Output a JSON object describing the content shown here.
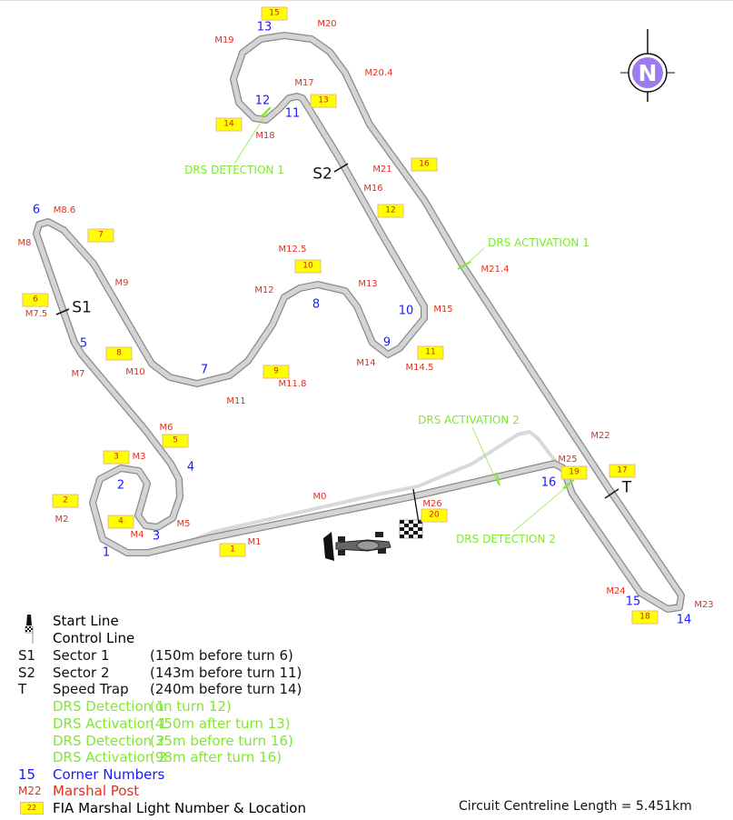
{
  "colors": {
    "corner": "#1a1aff",
    "marshal": "#e03020",
    "drs": "#80e830",
    "light_box": "#ffff00",
    "track": "#d4d4d4",
    "track_edge": "#8a8a8a",
    "pit_lane": "#d9d9d9",
    "north": "#9b7bf0"
  },
  "north": {
    "label": "N",
    "icon": "compass-icon"
  },
  "corners": [
    "1",
    "2",
    "3",
    "4",
    "5",
    "6",
    "7",
    "8",
    "9",
    "10",
    "11",
    "12",
    "13",
    "14",
    "15",
    "16"
  ],
  "marshal_posts": [
    "M0",
    "M1",
    "M2",
    "M3",
    "M4",
    "M5",
    "M6",
    "M7",
    "M7.5",
    "M8",
    "M8.6",
    "M9",
    "M10",
    "M11",
    "M11.8",
    "M12",
    "M12.5",
    "M13",
    "M14",
    "M14.5",
    "M15",
    "M16",
    "M17",
    "M18",
    "M19",
    "M20",
    "M20.4",
    "M21",
    "M21.4",
    "M22",
    "M23",
    "M24",
    "M25",
    "M26"
  ],
  "lights": [
    "1",
    "2",
    "3",
    "4",
    "5",
    "6",
    "7",
    "8",
    "9",
    "10",
    "11",
    "12",
    "13",
    "14",
    "15",
    "16",
    "17",
    "18",
    "19",
    "20"
  ],
  "drs_labels": [
    "DRS DETECTION 1",
    "DRS ACTIVATION 1",
    "DRS ACTIVATION 2",
    "DRS DETECTION 2"
  ],
  "sector_labels": [
    "S1",
    "S2",
    "T"
  ],
  "legend": {
    "start_line": "Start Line",
    "control_line": "Control Line",
    "rows": [
      {
        "key": "S1",
        "name": "Sector 1",
        "note": "(150m before turn 6)"
      },
      {
        "key": "S2",
        "name": "Sector 2",
        "note": "(143m before turn 11)"
      },
      {
        "key": "T",
        "name": "Speed Trap",
        "note": "(240m before turn 14)"
      },
      {
        "key": "",
        "name": "DRS Detection 1",
        "note": "(on turn 12)"
      },
      {
        "key": "",
        "name": "DRS Activation 1",
        "note": "(450m after turn 13)"
      },
      {
        "key": "",
        "name": "DRS Detection 2",
        "note": "(35m before turn 16)"
      },
      {
        "key": "",
        "name": "DRS Activation 2",
        "note": "(98m after turn 16)"
      }
    ],
    "corner_key": "15",
    "corner_text": "Corner Numbers",
    "marshal_key": "M22",
    "marshal_text": "Marshal Post",
    "light_key": "22",
    "light_text": "FIA Marshal Light Number & Location"
  },
  "footer": "Circuit Centreline Length = 5.451km"
}
